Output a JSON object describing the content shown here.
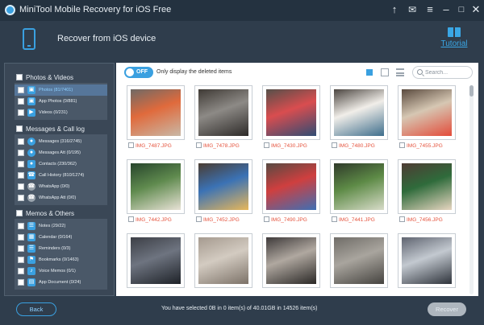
{
  "window": {
    "title": "MiniTool Mobile Recovery for iOS Free",
    "buttons": [
      "upload-icon",
      "mail-icon",
      "menu-icon",
      "minimize-icon",
      "maximize-icon",
      "close-icon"
    ]
  },
  "header": {
    "heading": "Recover from iOS device",
    "tutorial_label": "Tutorial"
  },
  "sidebar": {
    "groups": [
      {
        "label": "Photos & Videos",
        "items": [
          {
            "label": "Photos (81/7401)",
            "icon": "photo-icon",
            "selected": true
          },
          {
            "label": "App Photos (0/881)",
            "icon": "app-photo-icon",
            "selected": false
          },
          {
            "label": "Videos (0/231)",
            "icon": "video-icon",
            "selected": false
          }
        ]
      },
      {
        "label": "Messages & Call log",
        "items": [
          {
            "label": "Messages (316/2745)",
            "icon": "message-icon",
            "selected": false
          },
          {
            "label": "Messages Att (0/195)",
            "icon": "attachment-icon",
            "selected": false
          },
          {
            "label": "Contacts (230/362)",
            "icon": "contact-icon",
            "selected": false
          },
          {
            "label": "Call History (810/1274)",
            "icon": "call-icon",
            "selected": false
          },
          {
            "label": "WhatsApp (0/0)",
            "icon": "whatsapp-icon",
            "selected": false
          },
          {
            "label": "WhatsApp Att (0/0)",
            "icon": "whatsapp-att-icon",
            "selected": false
          }
        ]
      },
      {
        "label": "Memos & Others",
        "items": [
          {
            "label": "Notes (29/22)",
            "icon": "note-icon",
            "selected": false
          },
          {
            "label": "Calendar (0/164)",
            "icon": "calendar-icon",
            "selected": false
          },
          {
            "label": "Reminders (0/3)",
            "icon": "reminder-icon",
            "selected": false
          },
          {
            "label": "Bookmarks (0/1463)",
            "icon": "bookmark-icon",
            "selected": false
          },
          {
            "label": "Voice Memos (0/1)",
            "icon": "voice-memo-icon",
            "selected": false
          },
          {
            "label": "App Document (0/24)",
            "icon": "folder-icon",
            "selected": false
          }
        ]
      }
    ]
  },
  "toolbar": {
    "toggle_label": "OFF",
    "only_deleted_label": "Only display the deleted items",
    "view_icons": [
      "grid-view-icon",
      "calendar-view-icon",
      "list-view-icon"
    ],
    "search_placeholder": "Search..."
  },
  "photos": [
    {
      "name": "IMG_7487.JPG",
      "colors": [
        "#6f6a66",
        "#e06a3c",
        "#c9b8a6"
      ]
    },
    {
      "name": "IMG_7478.JPG",
      "colors": [
        "#3f3a35",
        "#8d8a86",
        "#2d2a28"
      ]
    },
    {
      "name": "IMG_7430.JPG",
      "colors": [
        "#55504a",
        "#d94d4f",
        "#2f4c73"
      ]
    },
    {
      "name": "IMG_7480.JPG",
      "colors": [
        "#4b4540",
        "#f1eee9",
        "#3e6e8c"
      ]
    },
    {
      "name": "IMG_7455.JPG",
      "colors": [
        "#5a4a3e",
        "#d6c7b3",
        "#e34c3a"
      ]
    },
    {
      "name": "IMG_7442.JPG",
      "colors": [
        "#27452c",
        "#5f8a4e",
        "#e8e2d6"
      ]
    },
    {
      "name": "IMG_7452.JPG",
      "colors": [
        "#4a3c31",
        "#3b72b5",
        "#e7b75a"
      ]
    },
    {
      "name": "IMG_7490.JPG",
      "colors": [
        "#574a42",
        "#cf3f3f",
        "#3e6fb5"
      ]
    },
    {
      "name": "IMG_7441.JPG",
      "colors": [
        "#2f3a2a",
        "#5d8a46",
        "#d8dcc9"
      ]
    },
    {
      "name": "IMG_7456.JPG",
      "colors": [
        "#4e3b33",
        "#2f6b3b",
        "#e7d6c1"
      ]
    },
    {
      "name": "",
      "colors": [
        "#3c3f46",
        "#6e7480",
        "#1e2228"
      ]
    },
    {
      "name": "",
      "colors": [
        "#a59a8f",
        "#d3cbc1",
        "#7c7268"
      ]
    },
    {
      "name": "",
      "colors": [
        "#3e3a3a",
        "#b0a8a0",
        "#2a2826"
      ]
    },
    {
      "name": "",
      "colors": [
        "#6f6c67",
        "#a9a59e",
        "#45433f"
      ]
    },
    {
      "name": "",
      "colors": [
        "#5f6470",
        "#c3c9d0",
        "#2e333b"
      ]
    }
  ],
  "footer": {
    "back_label": "Back",
    "status": "You have selected 0B in 0 item(s) of 40.01GB in 14526 item(s)",
    "recover_label": "Recover"
  }
}
